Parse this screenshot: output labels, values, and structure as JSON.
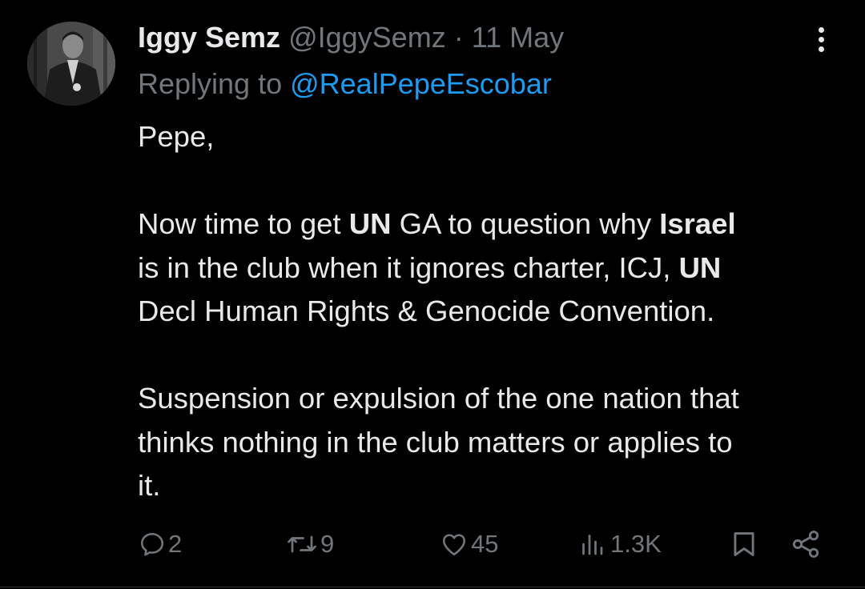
{
  "tweet": {
    "author_name": "Iggy Semz",
    "author_handle": "@IggySemz",
    "separator": "·",
    "date": "11 May",
    "replying_prefix": "Replying to ",
    "replying_to": "@RealPepeEscobar",
    "body": {
      "greeting": "Pepe,",
      "p2": {
        "t1": "Now time to get ",
        "b1": "UN",
        "t2": " GA to question why ",
        "b2": "Israel",
        "t3": "is in the club when it ignores charter, ICJ, ",
        "b3": "UN",
        "t4": "Decl Human Rights & Genocide Convention."
      },
      "p3": {
        "line1": "Suspension or expulsion of the one nation that",
        "line2": "thinks nothing in the club matters or applies to",
        "line3": "it."
      }
    }
  },
  "actions": {
    "replies": "2",
    "reposts": "9",
    "likes": "45",
    "views": "1.3K"
  },
  "icons": {
    "reply": "reply-icon",
    "repost": "repost-icon",
    "like": "heart-icon",
    "views": "views-icon",
    "bookmark": "bookmark-icon",
    "share": "share-icon",
    "more": "more-vertical-icon"
  },
  "colors": {
    "background": "#000000",
    "text": "#e7e9ea",
    "secondary": "#71767b",
    "link": "#1d9bf0"
  }
}
